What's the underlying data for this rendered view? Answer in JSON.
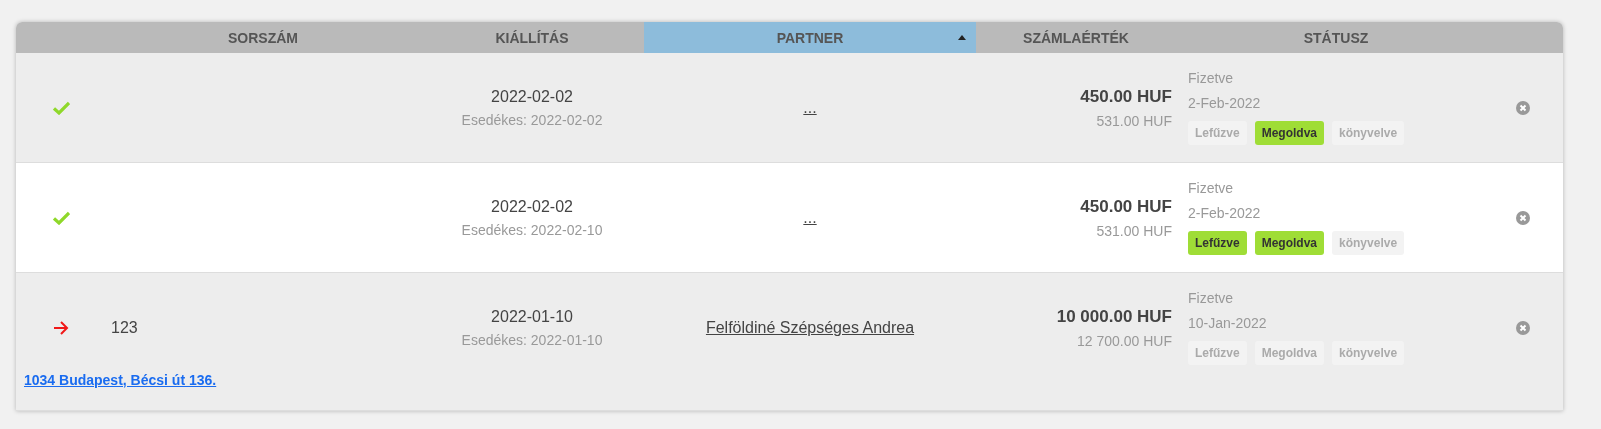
{
  "table": {
    "columns": [
      {
        "label": "SORSZÁM",
        "sorted": false
      },
      {
        "label": "KIÁLLÍTÁS",
        "sorted": false
      },
      {
        "label": "PARTNER",
        "sorted": true
      },
      {
        "label": "SZÁMLAÉRTÉK",
        "sorted": false
      },
      {
        "label": "STÁTUSZ",
        "sorted": false
      }
    ],
    "rows": [
      {
        "kind": "check",
        "shaded": true,
        "issued": "2022-02-02",
        "due": "Esedékes: 2022-02-02",
        "partner": "...",
        "amount": "450.00 HUF",
        "gross": "531.00 HUF",
        "status": "Fizetve",
        "status_date": "2-Feb-2022",
        "tags": [
          {
            "label": "Lefűzve",
            "on": false
          },
          {
            "label": "Megoldva",
            "on": true
          },
          {
            "label": "könyvelve",
            "on": false
          }
        ]
      },
      {
        "kind": "check",
        "shaded": false,
        "issued": "2022-02-02",
        "due": "Esedékes: 2022-02-10",
        "partner": "...",
        "amount": "450.00 HUF",
        "gross": "531.00 HUF",
        "status": "Fizetve",
        "status_date": "2-Feb-2022",
        "tags": [
          {
            "label": "Lefűzve",
            "on": true
          },
          {
            "label": "Megoldva",
            "on": true
          },
          {
            "label": "könyvelve",
            "on": false
          }
        ]
      },
      {
        "kind": "arrow",
        "shaded": true,
        "number": "123",
        "issued": "2022-01-10",
        "due": "Esedékes: 2022-01-10",
        "partner": "Felföldiné Szépséges Andrea",
        "amount": "10 000.00 HUF",
        "gross": "12 700.00 HUF",
        "status": "Fizetve",
        "status_date": "10-Jan-2022",
        "tags": [
          {
            "label": "Lefűzve",
            "on": false
          },
          {
            "label": "Megoldva",
            "on": false
          },
          {
            "label": "könyvelve",
            "on": false
          }
        ],
        "address": "1034 Budapest, Bécsi út 136."
      }
    ]
  }
}
